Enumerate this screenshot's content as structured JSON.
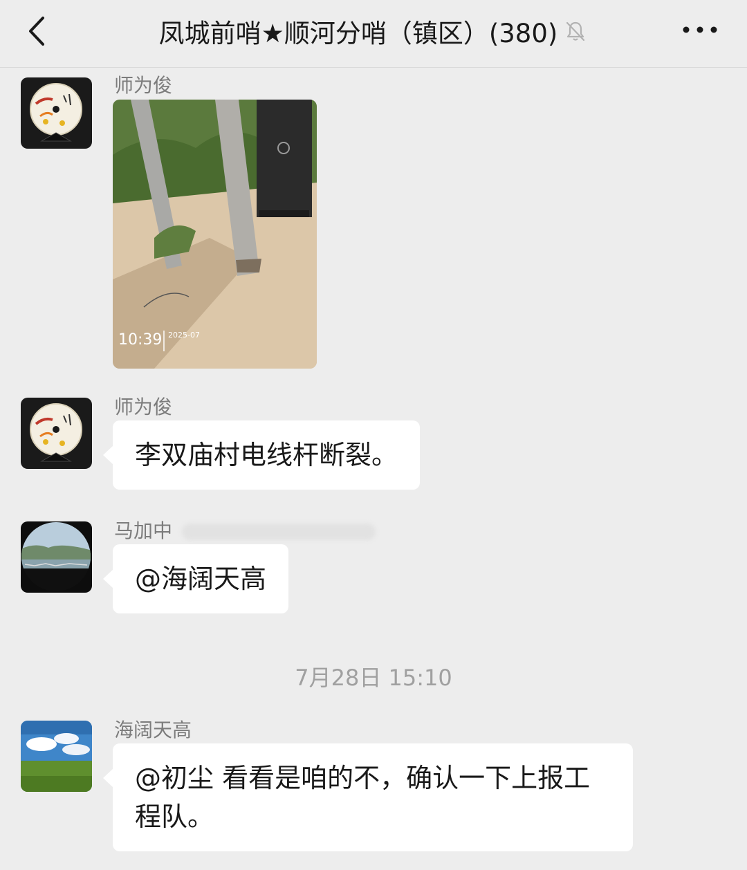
{
  "header": {
    "title": "凤城前哨★顺河分哨（镇区）(380)",
    "back_icon": "chevron-left-icon",
    "mute_icon": "bell-muted-icon",
    "more_icon": "more-dots-icon"
  },
  "messages": [
    {
      "sender": "师为俊",
      "type": "image",
      "image_overlay_time": "10:39",
      "image_overlay_date": "2025-07"
    },
    {
      "sender": "师为俊",
      "type": "text",
      "text": "李双庙村电线杆断裂。"
    },
    {
      "sender": "马加中",
      "type": "text",
      "text": "@海阔天高"
    },
    {
      "sender": "海阔天高",
      "type": "text",
      "text": "@初尘 看看是咱的不，确认一下上报工程队。"
    }
  ],
  "timestamp": "7月28日 15:10",
  "colors": {
    "background": "#ededed",
    "bubble": "#ffffff",
    "sender_text": "#7c7c7c",
    "timestamp_text": "#a0a0a0"
  }
}
